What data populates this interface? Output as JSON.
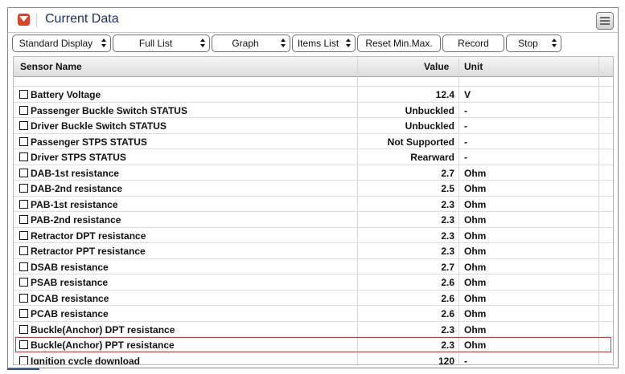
{
  "window": {
    "title": "Current Data"
  },
  "toolbar": {
    "buttons": [
      {
        "label": "Standard Display",
        "has_arrows": true
      },
      {
        "label": "Full List",
        "has_arrows": true
      },
      {
        "label": "Graph",
        "has_arrows": true
      },
      {
        "label": "Items List",
        "has_arrows": true
      },
      {
        "label": "Reset Min.Max.",
        "has_arrows": false
      },
      {
        "label": "Record",
        "has_arrows": false
      },
      {
        "label": "Stop",
        "has_arrows": true
      }
    ]
  },
  "table": {
    "columns": {
      "sensor": "Sensor Name",
      "value": "Value",
      "unit": "Unit"
    },
    "rows": [
      {
        "name": "Battery Voltage",
        "value": "12.4",
        "unit": "V"
      },
      {
        "name": "Passenger Buckle Switch STATUS",
        "value": "Unbuckled",
        "unit": "-"
      },
      {
        "name": "Driver Buckle Switch STATUS",
        "value": "Unbuckled",
        "unit": "-"
      },
      {
        "name": "Passenger STPS STATUS",
        "value": "Not Supported",
        "unit": "-"
      },
      {
        "name": "Driver STPS STATUS",
        "value": "Rearward",
        "unit": "-"
      },
      {
        "name": "DAB-1st resistance",
        "value": "2.7",
        "unit": "Ohm"
      },
      {
        "name": "DAB-2nd resistance",
        "value": "2.5",
        "unit": "Ohm"
      },
      {
        "name": "PAB-1st resistance",
        "value": "2.3",
        "unit": "Ohm"
      },
      {
        "name": "PAB-2nd resistance",
        "value": "2.3",
        "unit": "Ohm"
      },
      {
        "name": "Retractor DPT resistance",
        "value": "2.3",
        "unit": "Ohm"
      },
      {
        "name": "Retractor PPT resistance",
        "value": "2.3",
        "unit": "Ohm"
      },
      {
        "name": "DSAB resistance",
        "value": "2.7",
        "unit": "Ohm"
      },
      {
        "name": "PSAB resistance",
        "value": "2.6",
        "unit": "Ohm"
      },
      {
        "name": "DCAB resistance",
        "value": "2.6",
        "unit": "Ohm"
      },
      {
        "name": "PCAB resistance",
        "value": "2.6",
        "unit": "Ohm"
      },
      {
        "name": "Buckle(Anchor) DPT resistance",
        "value": "2.3",
        "unit": "Ohm"
      },
      {
        "name": "Buckle(Anchor) PPT resistance",
        "value": "2.3",
        "unit": "Ohm"
      },
      {
        "name": "Ignition cycle download",
        "value": "120",
        "unit": "-"
      }
    ]
  },
  "colors": {
    "title_text": "#1d2f66",
    "title_icon": "#d9452c",
    "highlight_border": "#d63a3a"
  },
  "icons": {
    "title": "collapse-icon",
    "window": "restore-icon",
    "row": "checkbox-icon"
  }
}
